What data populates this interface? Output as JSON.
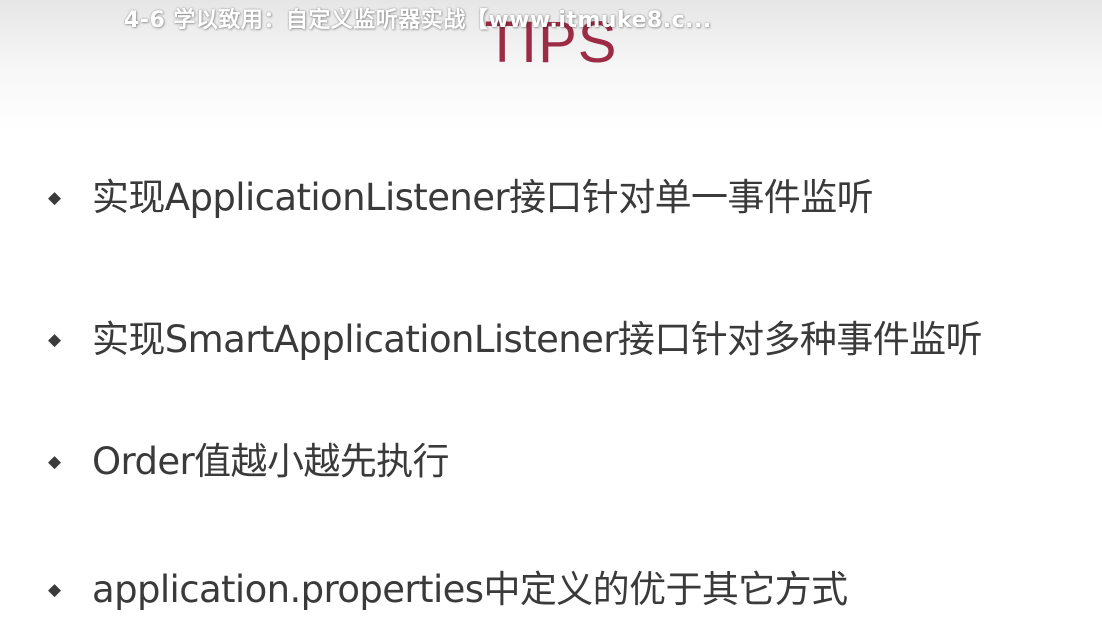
{
  "video": {
    "title": "4-6 学以致用：自定义监听器实战【www.itmuke8.c..."
  },
  "slide": {
    "title": "TIPS",
    "bullet_marker": "◆",
    "items": [
      "实现ApplicationListener接口针对单一事件监听",
      "实现SmartApplicationListener接口针对多种事件监听",
      "Order值越小越先执行",
      "application.properties中定义的优于其它方式"
    ]
  },
  "colors": {
    "title_accent": "#9c2b45",
    "text": "#3a3a3a",
    "background": "#ffffff"
  }
}
